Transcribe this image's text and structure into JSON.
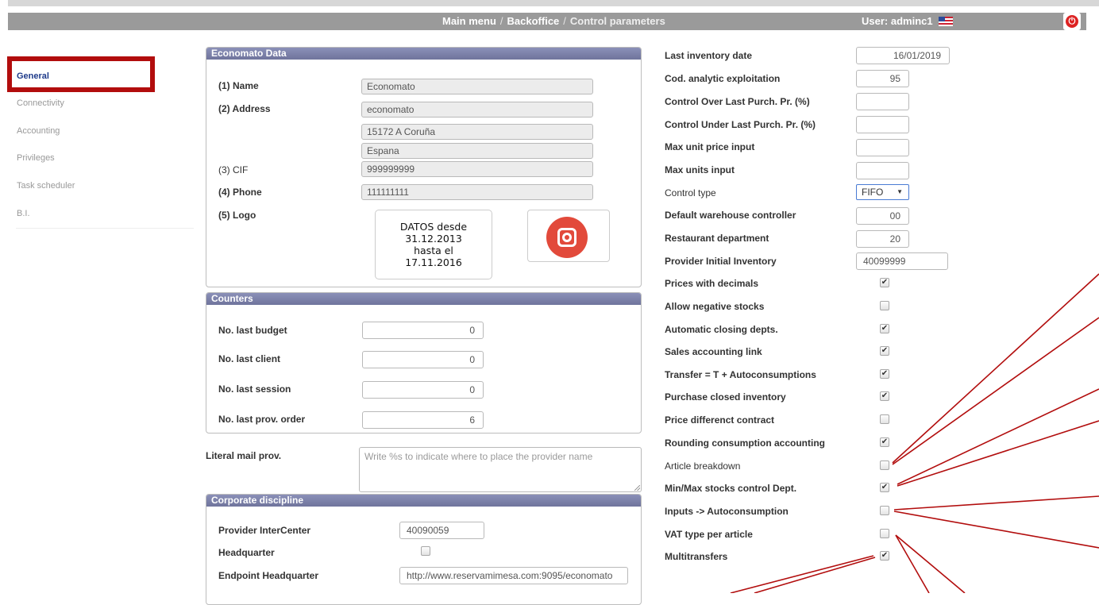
{
  "nav": {
    "crumb_main": "Main menu",
    "crumb_sep": "/",
    "crumb_backoffice": "Backoffice",
    "crumb_current": "Control parameters",
    "user": "User: adminc1"
  },
  "sidebar": {
    "items": [
      "General",
      "Connectivity",
      "Accounting",
      "Privileges",
      "Task scheduler",
      "B.I."
    ]
  },
  "economato": {
    "title": "Economato Data",
    "name_label": "(1) Name",
    "name_value": "Economato",
    "address_label": "(2) Address",
    "address_line1": "economato",
    "address_line2": "15172 A Coruña",
    "address_line3": "Espana",
    "cif_label": "(3) CIF",
    "cif_value": "999999999",
    "phone_label": "(4) Phone",
    "phone_value": "111111111",
    "logo_label": "(5) Logo",
    "logo_text": [
      "DATOS desde",
      "31.12.2013",
      "hasta el",
      "17.11.2016"
    ]
  },
  "counters": {
    "title": "Counters",
    "rows": [
      {
        "label": "No. last budget",
        "value": "0"
      },
      {
        "label": "No. last client",
        "value": "0"
      },
      {
        "label": "No. last session",
        "value": "0"
      },
      {
        "label": "No. last prov. order",
        "value": "6"
      }
    ]
  },
  "literal_mail": {
    "label": "Literal mail prov.",
    "placeholder": "Write %s to indicate where to place the provider name"
  },
  "corporate": {
    "title": "Corporate discipline",
    "provider_label": "Provider InterCenter",
    "provider_value": "40090059",
    "hq_label": "Headquarter",
    "endpoint_label": "Endpoint Headquarter",
    "endpoint_value": "http://www.reservamimesa.com:9095/economato"
  },
  "params": {
    "last_inventory_label": "Last inventory date",
    "last_inventory_value": "16/01/2019",
    "cod_analytic_label": "Cod. analytic exploitation",
    "cod_analytic_value": "95",
    "control_over_label": "Control Over Last Purch. Pr. (%)",
    "control_under_label": "Control Under Last Purch. Pr. (%)",
    "max_unit_price_label": "Max unit price input",
    "max_units_label": "Max units input",
    "control_type_label": "Control type",
    "control_type_value": "FIFO",
    "default_wh_label": "Default warehouse controller",
    "default_wh_value": "00",
    "restaurant_dept_label": "Restaurant department",
    "restaurant_dept_value": "20",
    "provider_initial_label": "Provider Initial Inventory",
    "provider_initial_value": "40099999"
  },
  "checks": [
    {
      "label": "Prices with decimals",
      "checked": "✔"
    },
    {
      "label": "Allow negative stocks",
      "checked": ""
    },
    {
      "label": "Automatic closing depts.",
      "checked": "✔"
    },
    {
      "label": "Sales accounting link",
      "checked": "✔"
    },
    {
      "label": "Transfer = T + Autoconsumptions",
      "checked": "✔"
    },
    {
      "label": "Purchase closed inventory",
      "checked": "✔"
    },
    {
      "label": "Price differenct contract",
      "checked": ""
    },
    {
      "label": "Rounding consumption accounting",
      "checked": "✔"
    },
    {
      "label": "Article breakdown",
      "checked": ""
    },
    {
      "label": "Min/Max stocks control Dept.",
      "checked": "✔"
    },
    {
      "label": "Inputs -> Autoconsumption",
      "checked": ""
    },
    {
      "label": "VAT type per article",
      "checked": ""
    },
    {
      "label": "Multitransfers",
      "checked": "✔"
    }
  ],
  "colors": {
    "highlight": "#b20d0d",
    "panel_header": "#7b80a8",
    "nav": "#9a9a9a"
  },
  "icons": {
    "flag": "us-flag-icon",
    "power": "power-icon",
    "logo": "instagram-icon"
  }
}
